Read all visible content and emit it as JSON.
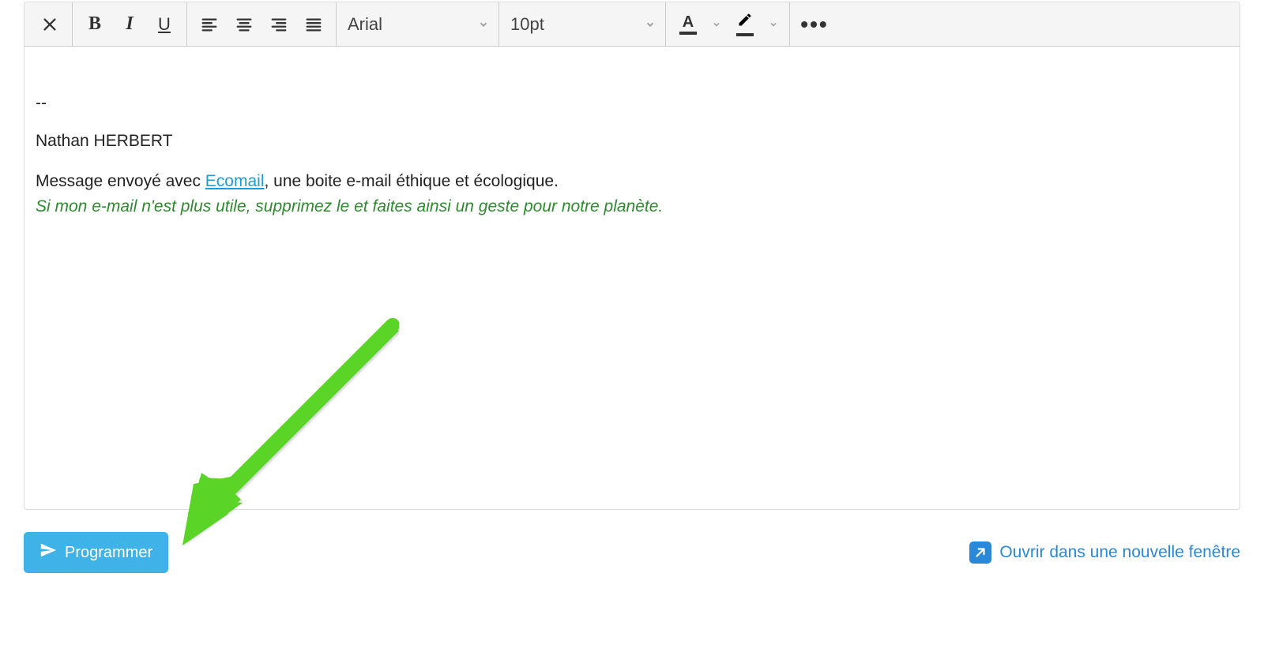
{
  "toolbar": {
    "font_family": "Arial",
    "font_size": "10pt",
    "text_color_bar": "#333333",
    "highlight_color_bar": "#333333"
  },
  "editor": {
    "divider": "--",
    "signature_name": "Nathan HERBERT",
    "message_prefix": "Message envoyé avec ",
    "link_text": "Ecomail",
    "message_suffix": ", une boite e-mail éthique et écologique.",
    "eco_line": "Si mon e-mail n'est plus utile, supprimez le et faites ainsi un geste pour notre planète."
  },
  "footer": {
    "schedule_label": "Programmer",
    "open_window_label": "Ouvrir dans une nouvelle fenêtre"
  },
  "colors": {
    "primary_button": "#3fb3e8",
    "link": "#2a88d8",
    "eco_green": "#2e8b2e",
    "arrow_green": "#5ad427"
  }
}
